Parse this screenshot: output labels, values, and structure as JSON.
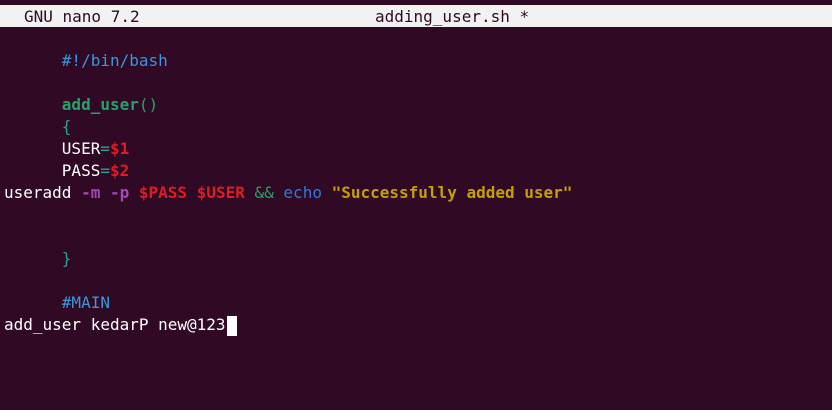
{
  "titlebar": {
    "app_name": "GNU nano 7.2",
    "filename": "adding_user.sh *"
  },
  "code": {
    "shebang": "#!/bin/bash",
    "func_name": "add_user",
    "func_parens": "()",
    "open_brace": "{",
    "user_var": "USER",
    "user_eq": "=",
    "user_val": "$1",
    "pass_var": "PASS",
    "pass_eq": "=",
    "pass_val": "$2",
    "cmd": "useradd",
    "flag_m": "-m",
    "flag_p": "-p",
    "var_pass": "$PASS",
    "var_user": "$USER",
    "and_op": "&&",
    "echo": "echo",
    "message": "\"Successfully added user\"",
    "close_brace": "}",
    "main_comment": "#MAIN",
    "call": "add_user kedarP new@123"
  },
  "colors": {
    "background": "#300a24",
    "titlebar": "#f2f2f2"
  }
}
